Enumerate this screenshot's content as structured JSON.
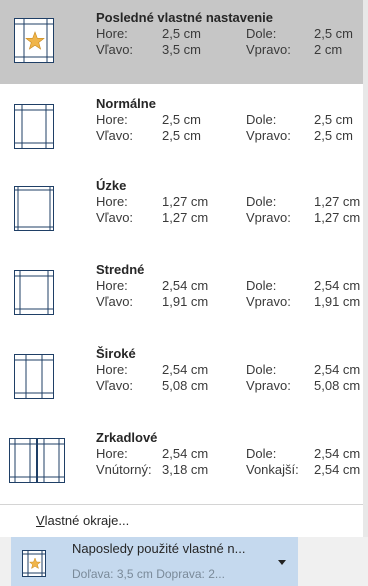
{
  "labels": {
    "top": "Hore:",
    "bottom": "Dole:",
    "left": "Vľavo:",
    "right": "Vpravo:",
    "inside": "Vnútorný:",
    "outside": "Vonkajší:"
  },
  "presets": [
    {
      "title": "Posledné vlastné nastavenie",
      "icon": "star-page-icon",
      "selected": true,
      "top": "2,5 cm",
      "bottom": "2,5 cm",
      "left": "3,5 cm",
      "right": "2 cm"
    },
    {
      "title": "Normálne",
      "icon": "normal-margins-page-icon",
      "top": "2,5 cm",
      "bottom": "2,5 cm",
      "left": "2,5 cm",
      "right": "2,5 cm"
    },
    {
      "title": "Úzke",
      "icon": "narrow-margins-page-icon",
      "top": "1,27 cm",
      "bottom": "1,27 cm",
      "left": "1,27 cm",
      "right": "1,27 cm"
    },
    {
      "title": "Stredné",
      "icon": "moderate-margins-page-icon",
      "top": "2,54 cm",
      "bottom": "2,54 cm",
      "left": "1,91 cm",
      "right": "1,91 cm"
    },
    {
      "title": "Široké",
      "icon": "wide-margins-page-icon",
      "top": "2,54 cm",
      "bottom": "2,54 cm",
      "left": "5,08 cm",
      "right": "5,08 cm"
    },
    {
      "title": "Zrkadlové",
      "icon": "mirrored-margins-page-icon",
      "top": "2,54 cm",
      "bottom": "2,54 cm",
      "inside": "3,18 cm",
      "outside": "2,54 cm"
    }
  ],
  "custom_margins": {
    "accel_key": "V",
    "rest": "lastné okraje..."
  },
  "last_used": {
    "title": "Naposledy použité vlastné n...",
    "subtitle": "Doľava: 3,5 cm   Doprava: 2..."
  },
  "colors": {
    "selected_bg": "#c6c6c6",
    "bottom_selected_bg": "#c5d9ee",
    "page_outline": "#1f3f66",
    "star": "#f0b54a"
  }
}
